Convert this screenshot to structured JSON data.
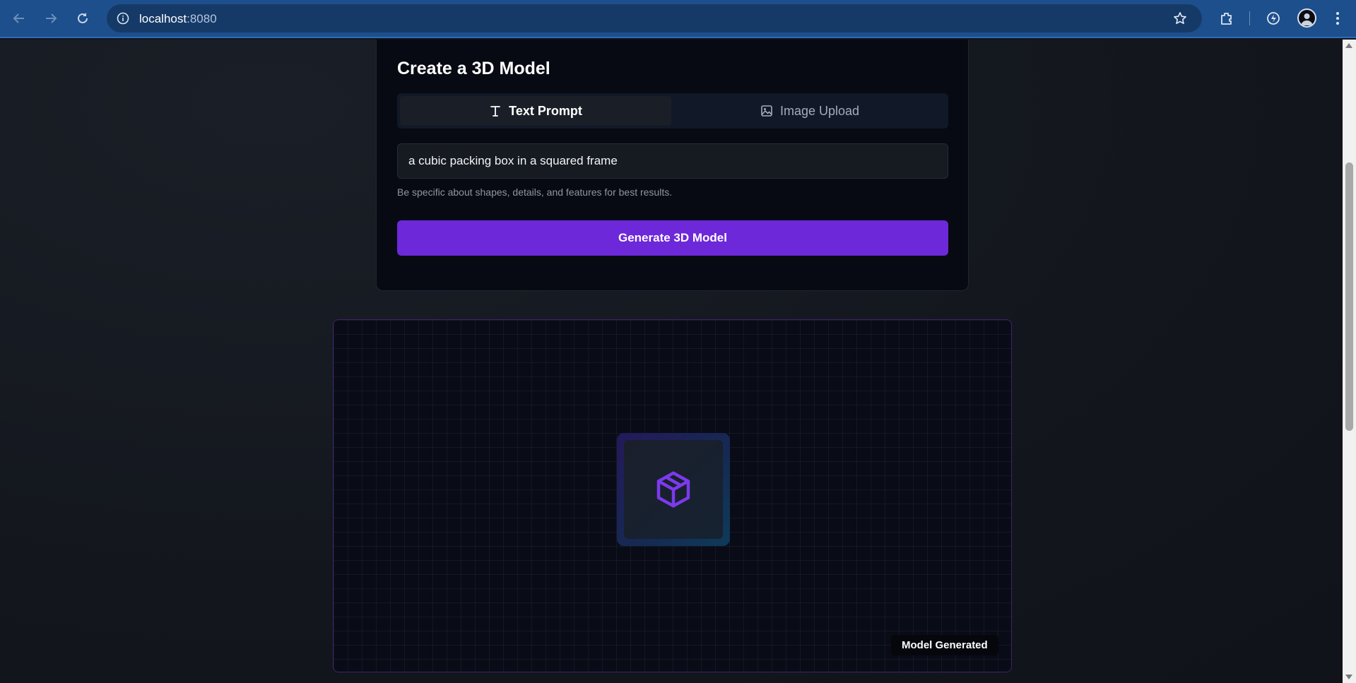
{
  "browser": {
    "url_host": "localhost",
    "url_port": ":8080",
    "icons": [
      "back-icon",
      "forward-icon",
      "reload-icon",
      "site-info-icon",
      "bookmark-star-icon",
      "extensions-icon",
      "performance-icon",
      "profile-avatar",
      "menu-icon"
    ]
  },
  "card": {
    "title": "Create a 3D Model",
    "tabs": [
      {
        "label": "Text Prompt",
        "icon": "text-icon",
        "active": true
      },
      {
        "label": "Image Upload",
        "icon": "image-icon",
        "active": false
      }
    ],
    "prompt": {
      "value": "a cubic packing box in a squared frame",
      "placeholder": ""
    },
    "hint": "Be specific about shapes, details, and features for best results.",
    "generate_label": "Generate 3D Model"
  },
  "viewer": {
    "model_icon": "package-box-icon",
    "status": "Model Generated"
  },
  "colors": {
    "accent": "#6d28d9",
    "browser_bar": "#1d4f8c",
    "card_bg": "#070a12",
    "viewer_border": "#3d2470"
  }
}
